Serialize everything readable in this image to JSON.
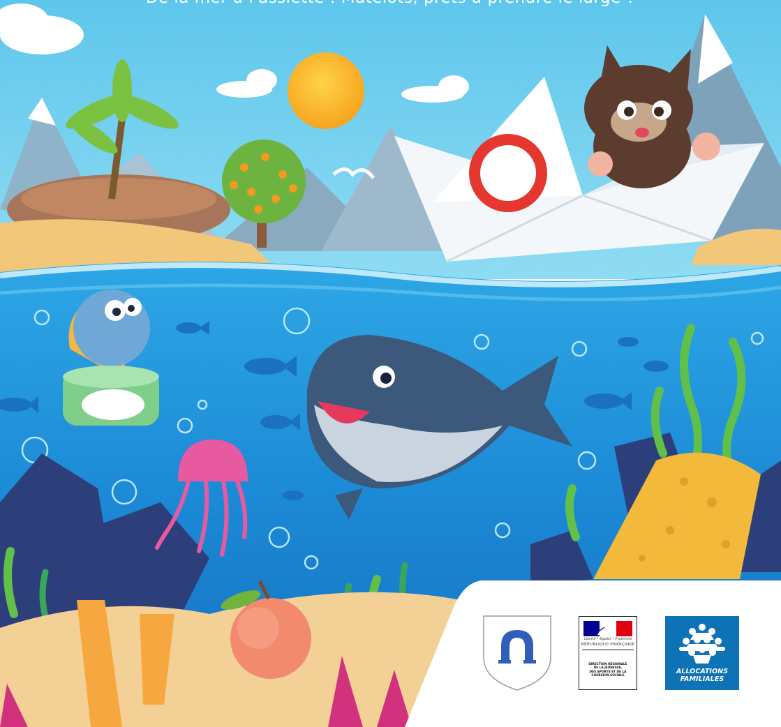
{
  "tagline": "De la mer à l'assiette : Matelots, prêts à prendre le large ?",
  "logos": {
    "marseille": {
      "icon": "horseshoe-shield-icon"
    },
    "republique_francaise": {
      "motto": "Liberté • Égalité • Fraternité",
      "name": "RÉPUBLIQUE FRANÇAISE",
      "subtitle": "DIRECTION RÉGIONALE\nDE LA JEUNESSE,\nDES SPORTS ET DE LA\nCOHÉSION SOCIALE"
    },
    "caf": {
      "line1": "ALLOCATIONS",
      "line2": "FAMILIALES",
      "color": "#0e72b7"
    }
  },
  "colors": {
    "sky": "#5ec3ea",
    "ocean": "#1f8fd8",
    "sand": "#f3c77a"
  }
}
